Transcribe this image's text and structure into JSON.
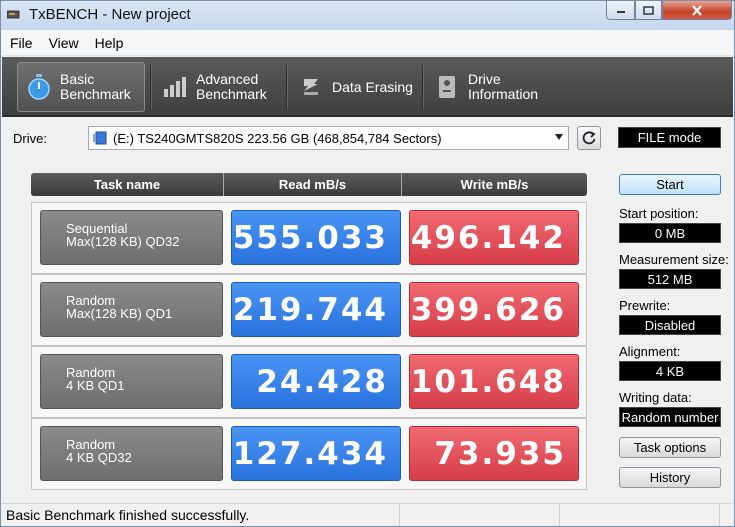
{
  "window": {
    "title": "TxBENCH - New project"
  },
  "menu": {
    "items": [
      "File",
      "View",
      "Help"
    ]
  },
  "tabs": [
    {
      "line1": "Basic",
      "line2": "Benchmark",
      "icon": "stopwatch-icon",
      "active": true
    },
    {
      "line1": "Advanced",
      "line2": "Benchmark",
      "icon": "bar-chart-icon",
      "active": false
    },
    {
      "line1": "Data Erasing",
      "line2": "",
      "icon": "eraser-icon",
      "active": false
    },
    {
      "line1": "Drive",
      "line2": "Information",
      "icon": "drive-info-icon",
      "active": false
    }
  ],
  "drive": {
    "label": "Drive:",
    "selected": "(E:) TS240GMTS820S  223.56 GB (468,854,784 Sectors)",
    "mode": "FILE mode"
  },
  "table": {
    "headers": [
      "Task name",
      "Read mB/s",
      "Write mB/s"
    ],
    "rows": [
      {
        "name1": "Sequential",
        "name2": "Max(128 KB) QD32",
        "read": "555.033",
        "write": "496.142"
      },
      {
        "name1": "Random",
        "name2": "Max(128 KB) QD1",
        "read": "219.744",
        "write": "399.626"
      },
      {
        "name1": "Random",
        "name2": "4 KB QD1",
        "read": "24.428",
        "write": "101.648"
      },
      {
        "name1": "Random",
        "name2": "4 KB QD32",
        "read": "127.434",
        "write": "73.935"
      }
    ]
  },
  "panel": {
    "start_label": "Start",
    "start_position_label": "Start position:",
    "start_position_value": "0 MB",
    "measurement_size_label": "Measurement size:",
    "measurement_size_value": "512 MB",
    "prewrite_label": "Prewrite:",
    "prewrite_value": "Disabled",
    "alignment_label": "Alignment:",
    "alignment_value": "4 KB",
    "writing_data_label": "Writing data:",
    "writing_data_value": "Random number",
    "task_options_label": "Task options",
    "history_label": "History"
  },
  "status": {
    "text": "Basic Benchmark finished successfully."
  },
  "colors": {
    "read": "#3584ea",
    "write": "#e2505a",
    "toolbar": "#4a4a4a"
  }
}
